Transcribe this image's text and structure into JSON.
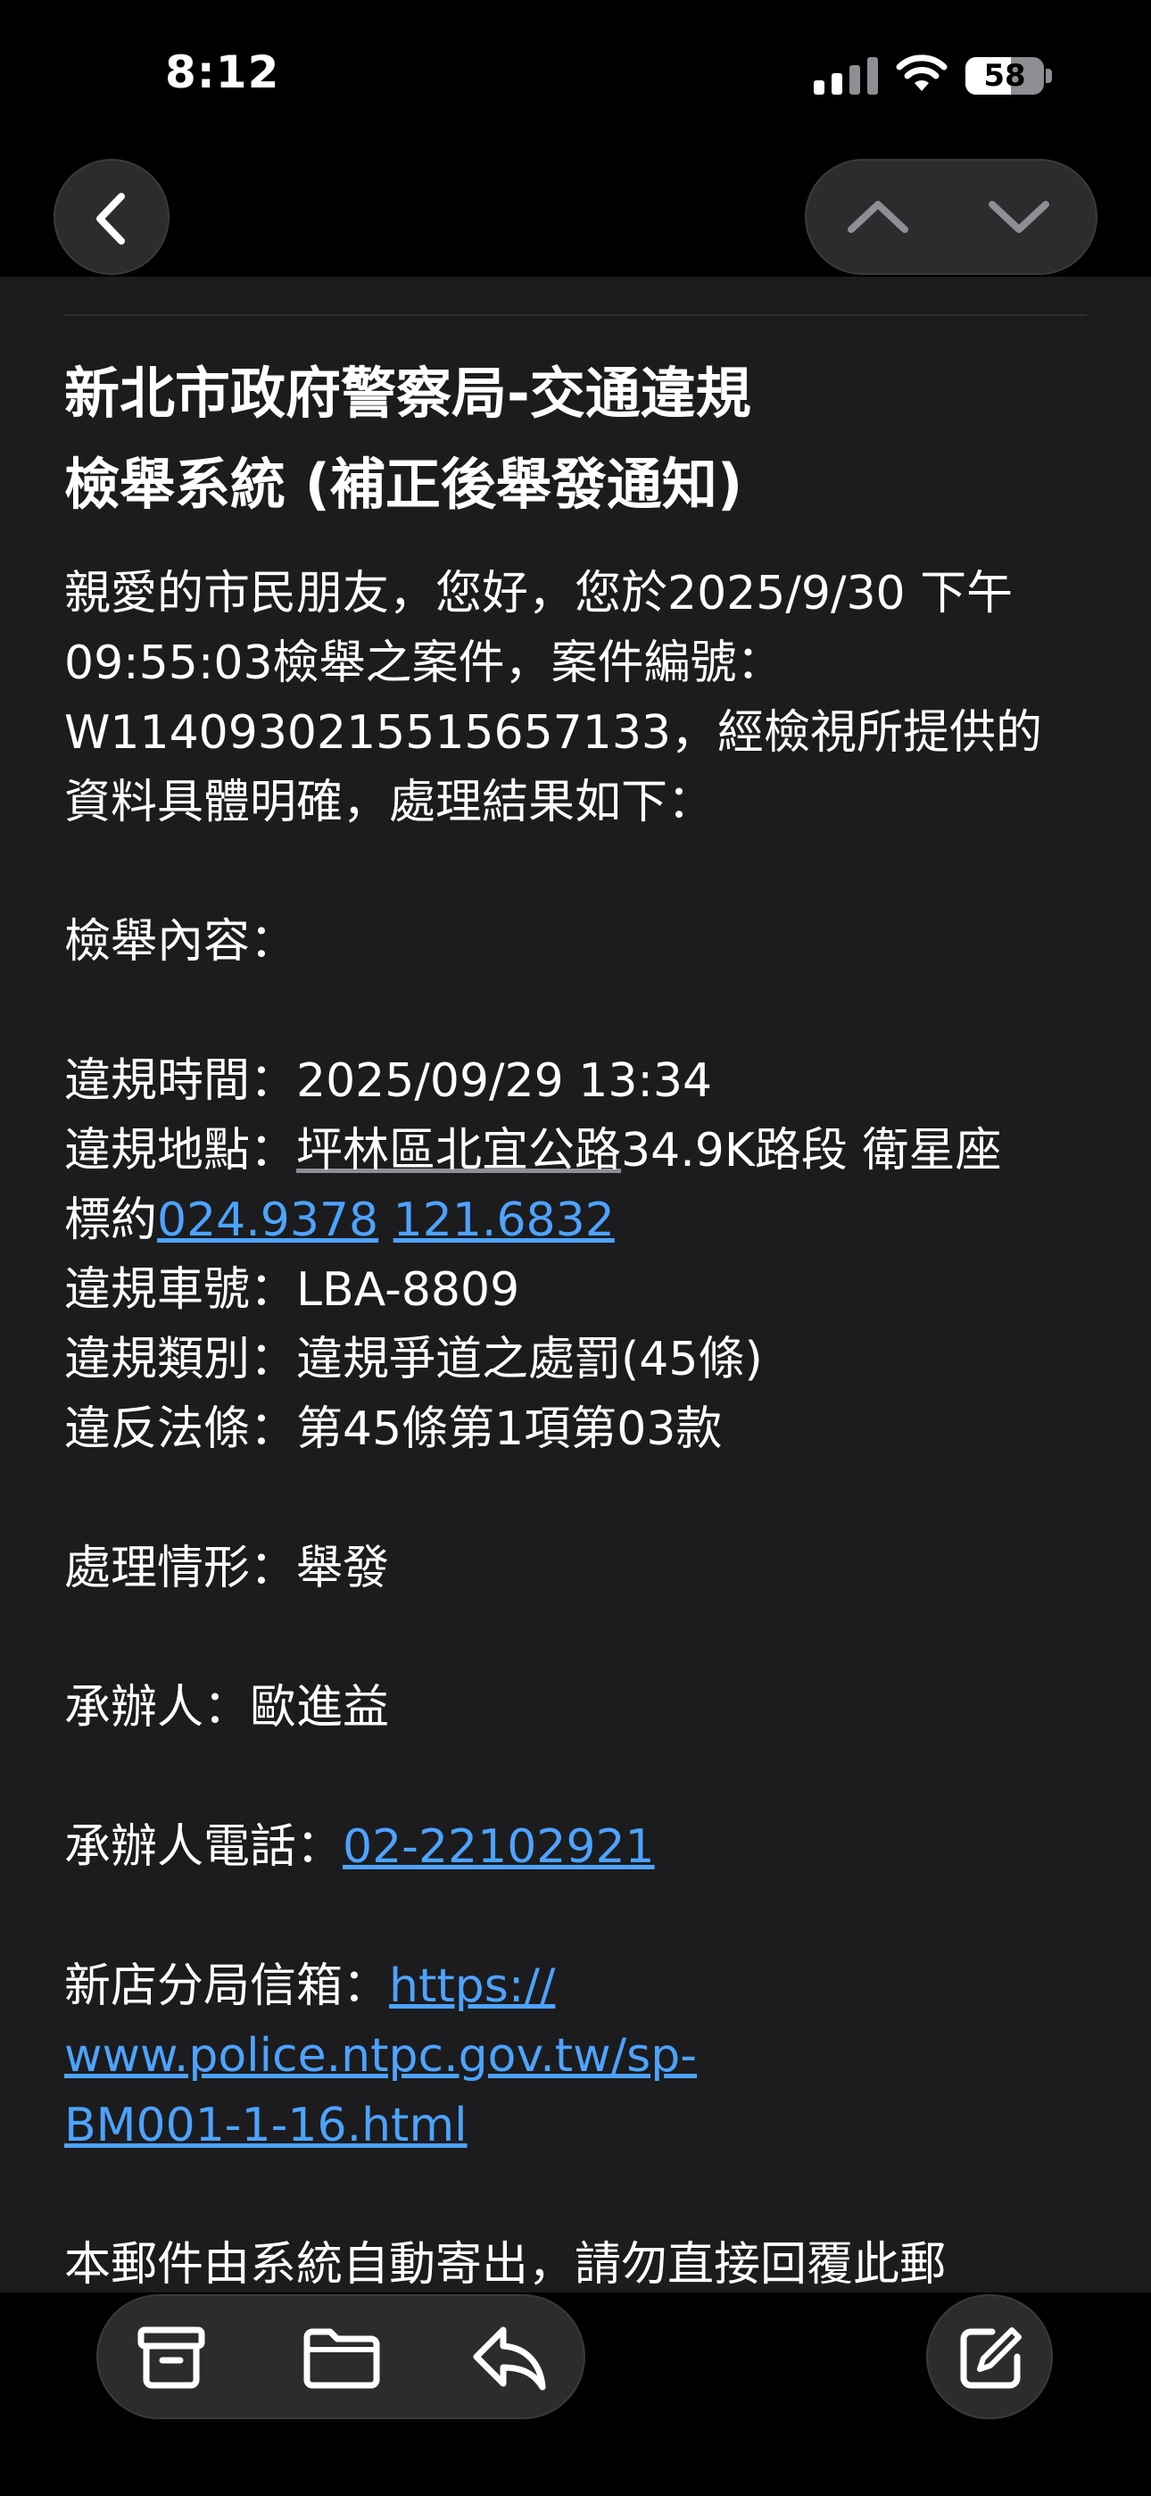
{
  "status_bar": {
    "time": "8:12",
    "battery": "58",
    "battery_level_percent": 58
  },
  "icons": {
    "back": "chevron-left-icon",
    "prev": "chevron-up-icon",
    "next": "chevron-down-icon",
    "archive": "archive-icon",
    "folder": "folder-icon",
    "reply": "reply-icon",
    "compose": "compose-icon"
  },
  "colors": {
    "link": "#4da3ff",
    "background": "#1c1c1e",
    "bars": "#000000"
  },
  "email": {
    "subject_line1": "新北市政府警察局-交通違規",
    "subject_line2": "檢舉系統 (補正後舉發通知)",
    "intro_line1": "親愛的市民朋友，您好，您於2025/9/30 下午",
    "intro_line2": "09:55:03檢舉之案件，案件編號：",
    "intro_line3": "W1140930215515657133，經檢視所提供的",
    "intro_line4": "資料具體明確，處理結果如下：",
    "content_heading": "檢舉內容：",
    "violation_time": "違規時間：2025/09/29 13:34",
    "location_prefix": "違規地點：",
    "location_place": "坪林區北宜公路",
    "location_rest": "34.9K路段 衛星座",
    "coords_prefix": "標約",
    "coord_lat": "024.9378",
    "coord_lon": "121.6832",
    "plate": "違規車號：LBA-8809",
    "category": "違規類別：違規爭道之處罰(45條)",
    "law": "違反法條：第45條第1項第03款",
    "handling": "處理情形：舉發",
    "officer": "承辦人：歐進益",
    "phone_label": "承辦人電話：",
    "phone_number": "02-22102921",
    "mailbox_label": "新店分局信箱：",
    "mailbox_url_line1": "https://",
    "mailbox_url_line2": "www.police.ntpc.gov.tw/sp-",
    "mailbox_url_line3": "BM001-1-16.html",
    "footer_partial": "本郵件由系統自動寄出，請勿直接回覆此郵"
  }
}
